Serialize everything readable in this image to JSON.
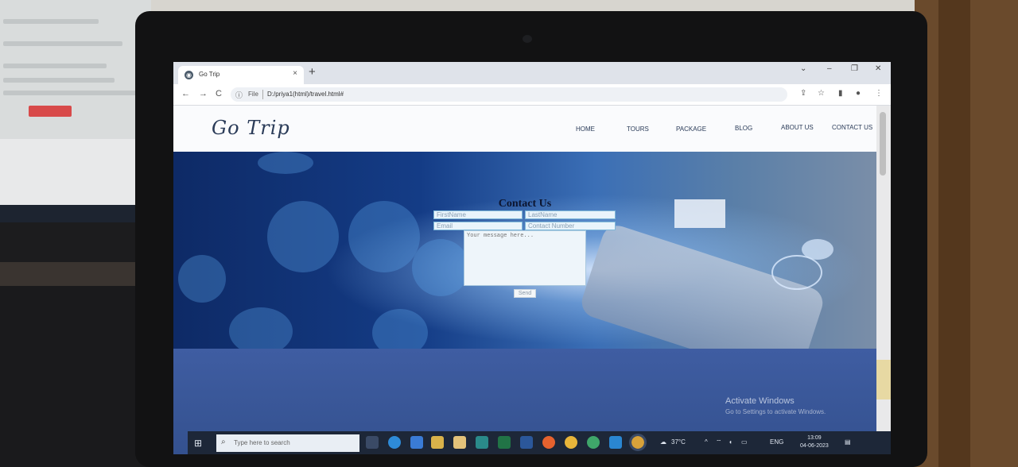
{
  "browser": {
    "tab_title": "Go Trip",
    "tab_close": "×",
    "new_tab": "+",
    "win_dropdown": "⌄",
    "win_minimize": "–",
    "win_restore": "❐",
    "win_close": "✕",
    "back": "←",
    "forward": "→",
    "reload": "C",
    "info_icon": "ⓘ",
    "file_label": "File",
    "url": "D:/priya1(html)/travel.html#",
    "share": "⇪",
    "star": "☆",
    "sidepanel": "▮",
    "profile": "●",
    "menu": "⋮"
  },
  "site": {
    "logo": "Go Trip",
    "nav": [
      "HOME",
      "TOURS",
      "PACKAGE",
      "BLOG",
      "ABOUT US",
      "CONTACT US"
    ]
  },
  "contact": {
    "title": "Contact Us",
    "first_name_placeholder": "FirstName",
    "last_name_placeholder": "LastName",
    "email_placeholder": "Email",
    "contact_number_placeholder": "Contact Number",
    "message_placeholder": "Your message here...",
    "send_label": "Send"
  },
  "watermark": {
    "line1": "Activate Windows",
    "line2": "Go to Settings to activate Windows."
  },
  "taskbar": {
    "start": "⊞",
    "search_icon": "⌕",
    "search_placeholder": "Type here to search",
    "weather": "37°C",
    "tray_arrow": "^",
    "language": "ENG",
    "time": "13:09",
    "date": "04-06-2023"
  },
  "colors": {
    "header_bg": "#fafbfd",
    "logo": "#2a3b58",
    "hero_dark": "#0e2a66",
    "lower_band": "#3f5da2",
    "taskbar": "#1d2738"
  }
}
